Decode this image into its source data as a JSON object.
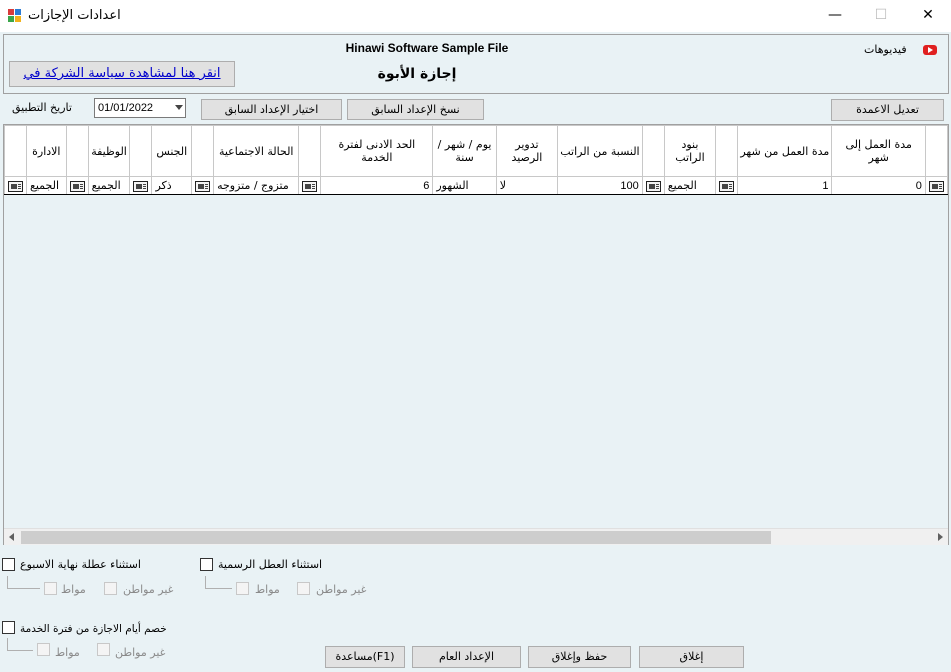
{
  "window": {
    "title": "اعدادات الإجازات",
    "minimize": "—",
    "maximize": "☐",
    "close": "✕"
  },
  "header": {
    "app_name": "Hinawi Software Sample File",
    "leave_name": "إجازة الأبوة",
    "videos_label": "فيديوهات",
    "videos_icon": "youtube-icon",
    "policy_link": "انقر هنا لمشاهدة سياسة الشركة في"
  },
  "toolbar": {
    "apply_date_label": "تاريخ التطبيق",
    "apply_date_value": "01/01/2022",
    "choose_previous": "اختيار الإعداد السابق",
    "copy_previous": "نسخ الإعداد السابق",
    "edit_columns": "تعديل الاعمدة"
  },
  "grid": {
    "headers": {
      "work_to": "مدة العمل إلى شهر",
      "work_from": "مدة العمل من شهر",
      "salary_items": "بنود الراتب",
      "percent_salary": "النسبة من الراتب",
      "carry_balance": "تدوير الرصيد",
      "unit": "يوم / شهر / سنة",
      "min_service": "الحد الادنى لفترة الخدمة",
      "marital": "الحالة الاجتماعية",
      "gender": "الجنس",
      "job": "الوظيفة",
      "department": "الادارة"
    },
    "row": {
      "work_to": "0",
      "work_from": "1",
      "salary_items": "الجميع",
      "percent_salary": "100",
      "carry_balance": "لا",
      "unit": "الشهور",
      "min_service": "6",
      "marital": "متزوج / متزوجه",
      "gender": "ذكر",
      "job": "الجميع",
      "department": "الجميع"
    }
  },
  "options": {
    "official_holidays": "استثناء العطل الرسمية",
    "weekend": "استثناء عطلة نهاية الاسبوع",
    "deduct_service": "خصم أيام الاجازة من فترة الخدمة",
    "non_citizen": "غير مواطن",
    "citizen": "مواط"
  },
  "footer": {
    "close": "إغلاق",
    "save_close": "حفظ وإغلاق",
    "general_settings": "الإعداد العام",
    "help": "مساعدة(F1)"
  },
  "colors": {
    "background": "#e9f2f5",
    "link": "#0000cc"
  }
}
